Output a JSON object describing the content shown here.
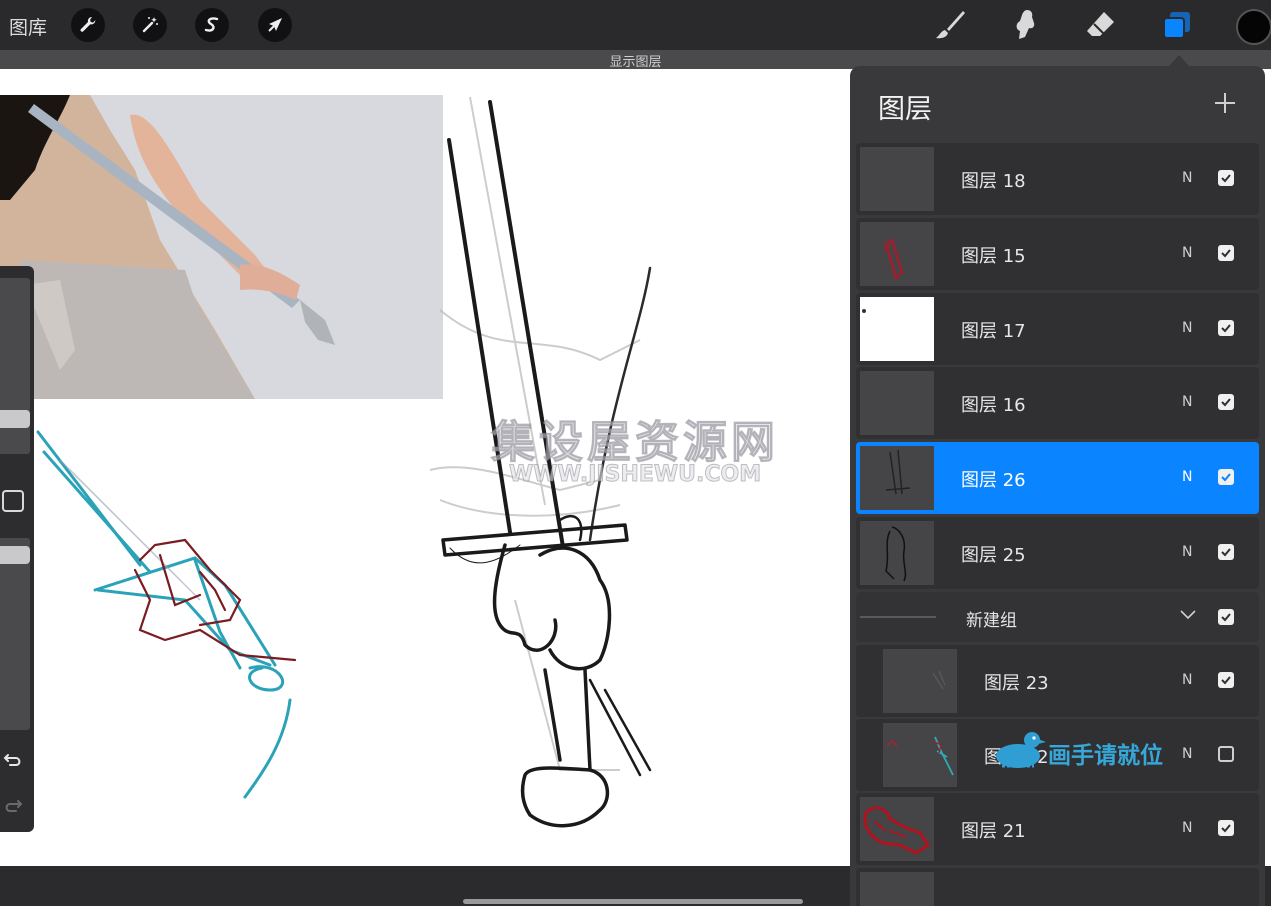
{
  "toolbar": {
    "gallery_label": "图库",
    "left_tools": [
      {
        "icon": "wrench-icon",
        "name": "actions"
      },
      {
        "icon": "magic-wand-icon",
        "name": "adjustments"
      },
      {
        "icon": "selection-s-icon",
        "name": "selection"
      },
      {
        "icon": "arrow-cursor-icon",
        "name": "transform"
      }
    ],
    "right_tools": [
      {
        "icon": "brush-icon",
        "name": "paint"
      },
      {
        "icon": "smudge-icon",
        "name": "smudge"
      },
      {
        "icon": "eraser-icon",
        "name": "eraser"
      },
      {
        "icon": "layers-icon",
        "name": "layers",
        "active": true
      }
    ],
    "active_color": "#050505"
  },
  "subbar": {
    "label": "显示图层"
  },
  "layers_panel": {
    "title": "图层",
    "add_icon": "plus-icon",
    "layers": [
      {
        "name": "图层 18",
        "blend": "N",
        "visible": true,
        "selected": false
      },
      {
        "name": "图层 15",
        "blend": "N",
        "visible": true,
        "selected": false
      },
      {
        "name": "图层 17",
        "blend": "N",
        "visible": true,
        "selected": false
      },
      {
        "name": "图层 16",
        "blend": "N",
        "visible": true,
        "selected": false
      },
      {
        "name": "图层 26",
        "blend": "N",
        "visible": true,
        "selected": true
      },
      {
        "name": "图层 25",
        "blend": "N",
        "visible": true,
        "selected": false
      },
      {
        "name": "新建组",
        "is_group": true,
        "visible": true,
        "expanded": true
      },
      {
        "name": "图层 23",
        "blend": "N",
        "visible": true,
        "selected": false,
        "in_group": true
      },
      {
        "name": "图层 22",
        "blend": "N",
        "visible": false,
        "selected": false,
        "in_group": true
      },
      {
        "name": "图层 21",
        "blend": "N",
        "visible": true,
        "selected": false
      }
    ]
  },
  "accent_color": "#0a84ff",
  "watermarks": {
    "main": "集设屋资源网",
    "sub": "WWW.JISHEWU.COM",
    "channel": "画手请就位"
  }
}
